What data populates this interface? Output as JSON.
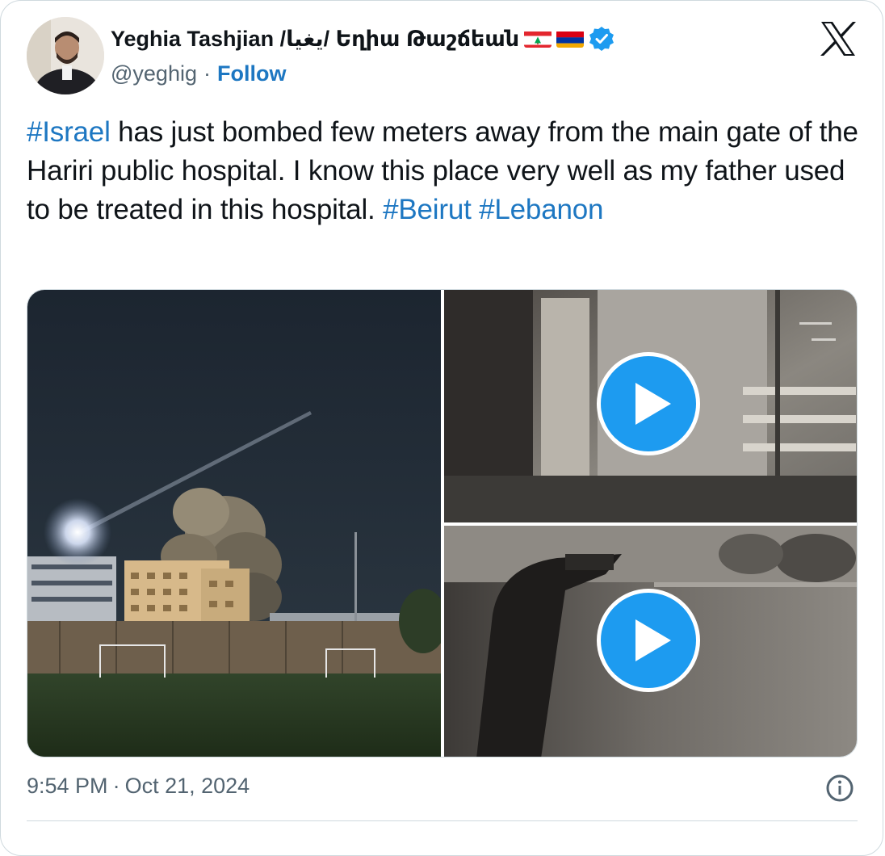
{
  "author": {
    "display_name": "Yeghia Tashjian /يغيا/ Եղիա Թաշճեան",
    "flags": [
      "lebanon-flag-icon",
      "armenia-flag-icon"
    ],
    "handle": "@yeghig",
    "separator": "·",
    "follow_label": "Follow",
    "verified": true
  },
  "platform": {
    "logo": "x-logo-icon"
  },
  "tweet": {
    "segments": [
      {
        "text": "#Israel",
        "hashtag": true
      },
      {
        "text": " has just bombed few meters away from the main gate of the Hariri public hospital.  I know this place very well as my father used to be treated in this hospital. ",
        "hashtag": false
      },
      {
        "text": "#Beirut",
        "hashtag": true
      },
      {
        "text": " ",
        "hashtag": false
      },
      {
        "text": "#Lebanon",
        "hashtag": true
      }
    ]
  },
  "media": {
    "items": [
      {
        "kind": "photo",
        "description_icon": "night-smoke-photo"
      },
      {
        "kind": "video",
        "play_icon": "play-icon"
      },
      {
        "kind": "video",
        "play_icon": "play-icon"
      }
    ]
  },
  "footer": {
    "time": "9:54 PM",
    "separator": "·",
    "date": "Oct 21, 2024",
    "info_icon": "info-icon"
  },
  "colors": {
    "link": "#1d77c2",
    "secondary_text": "#536471",
    "verified": "#1d9bf0",
    "border": "#cfd9de"
  }
}
